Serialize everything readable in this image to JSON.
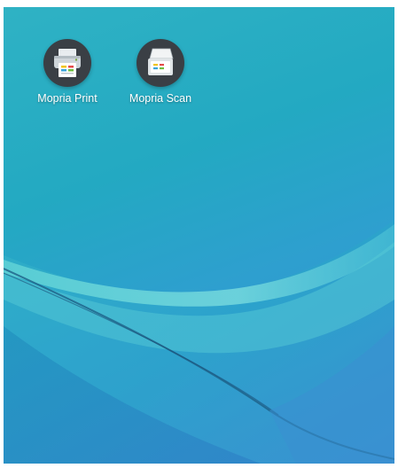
{
  "home_screen": {
    "apps": [
      {
        "label": "Mopria Print",
        "icon": "printer-icon"
      },
      {
        "label": "Mopria Scan",
        "icon": "scanner-icon"
      }
    ]
  },
  "colors": {
    "wallpaper_top": "#2fb2c4",
    "wallpaper_bottom": "#3a93d2",
    "icon_background": "#3a3f45",
    "label_text": "#ffffff"
  }
}
